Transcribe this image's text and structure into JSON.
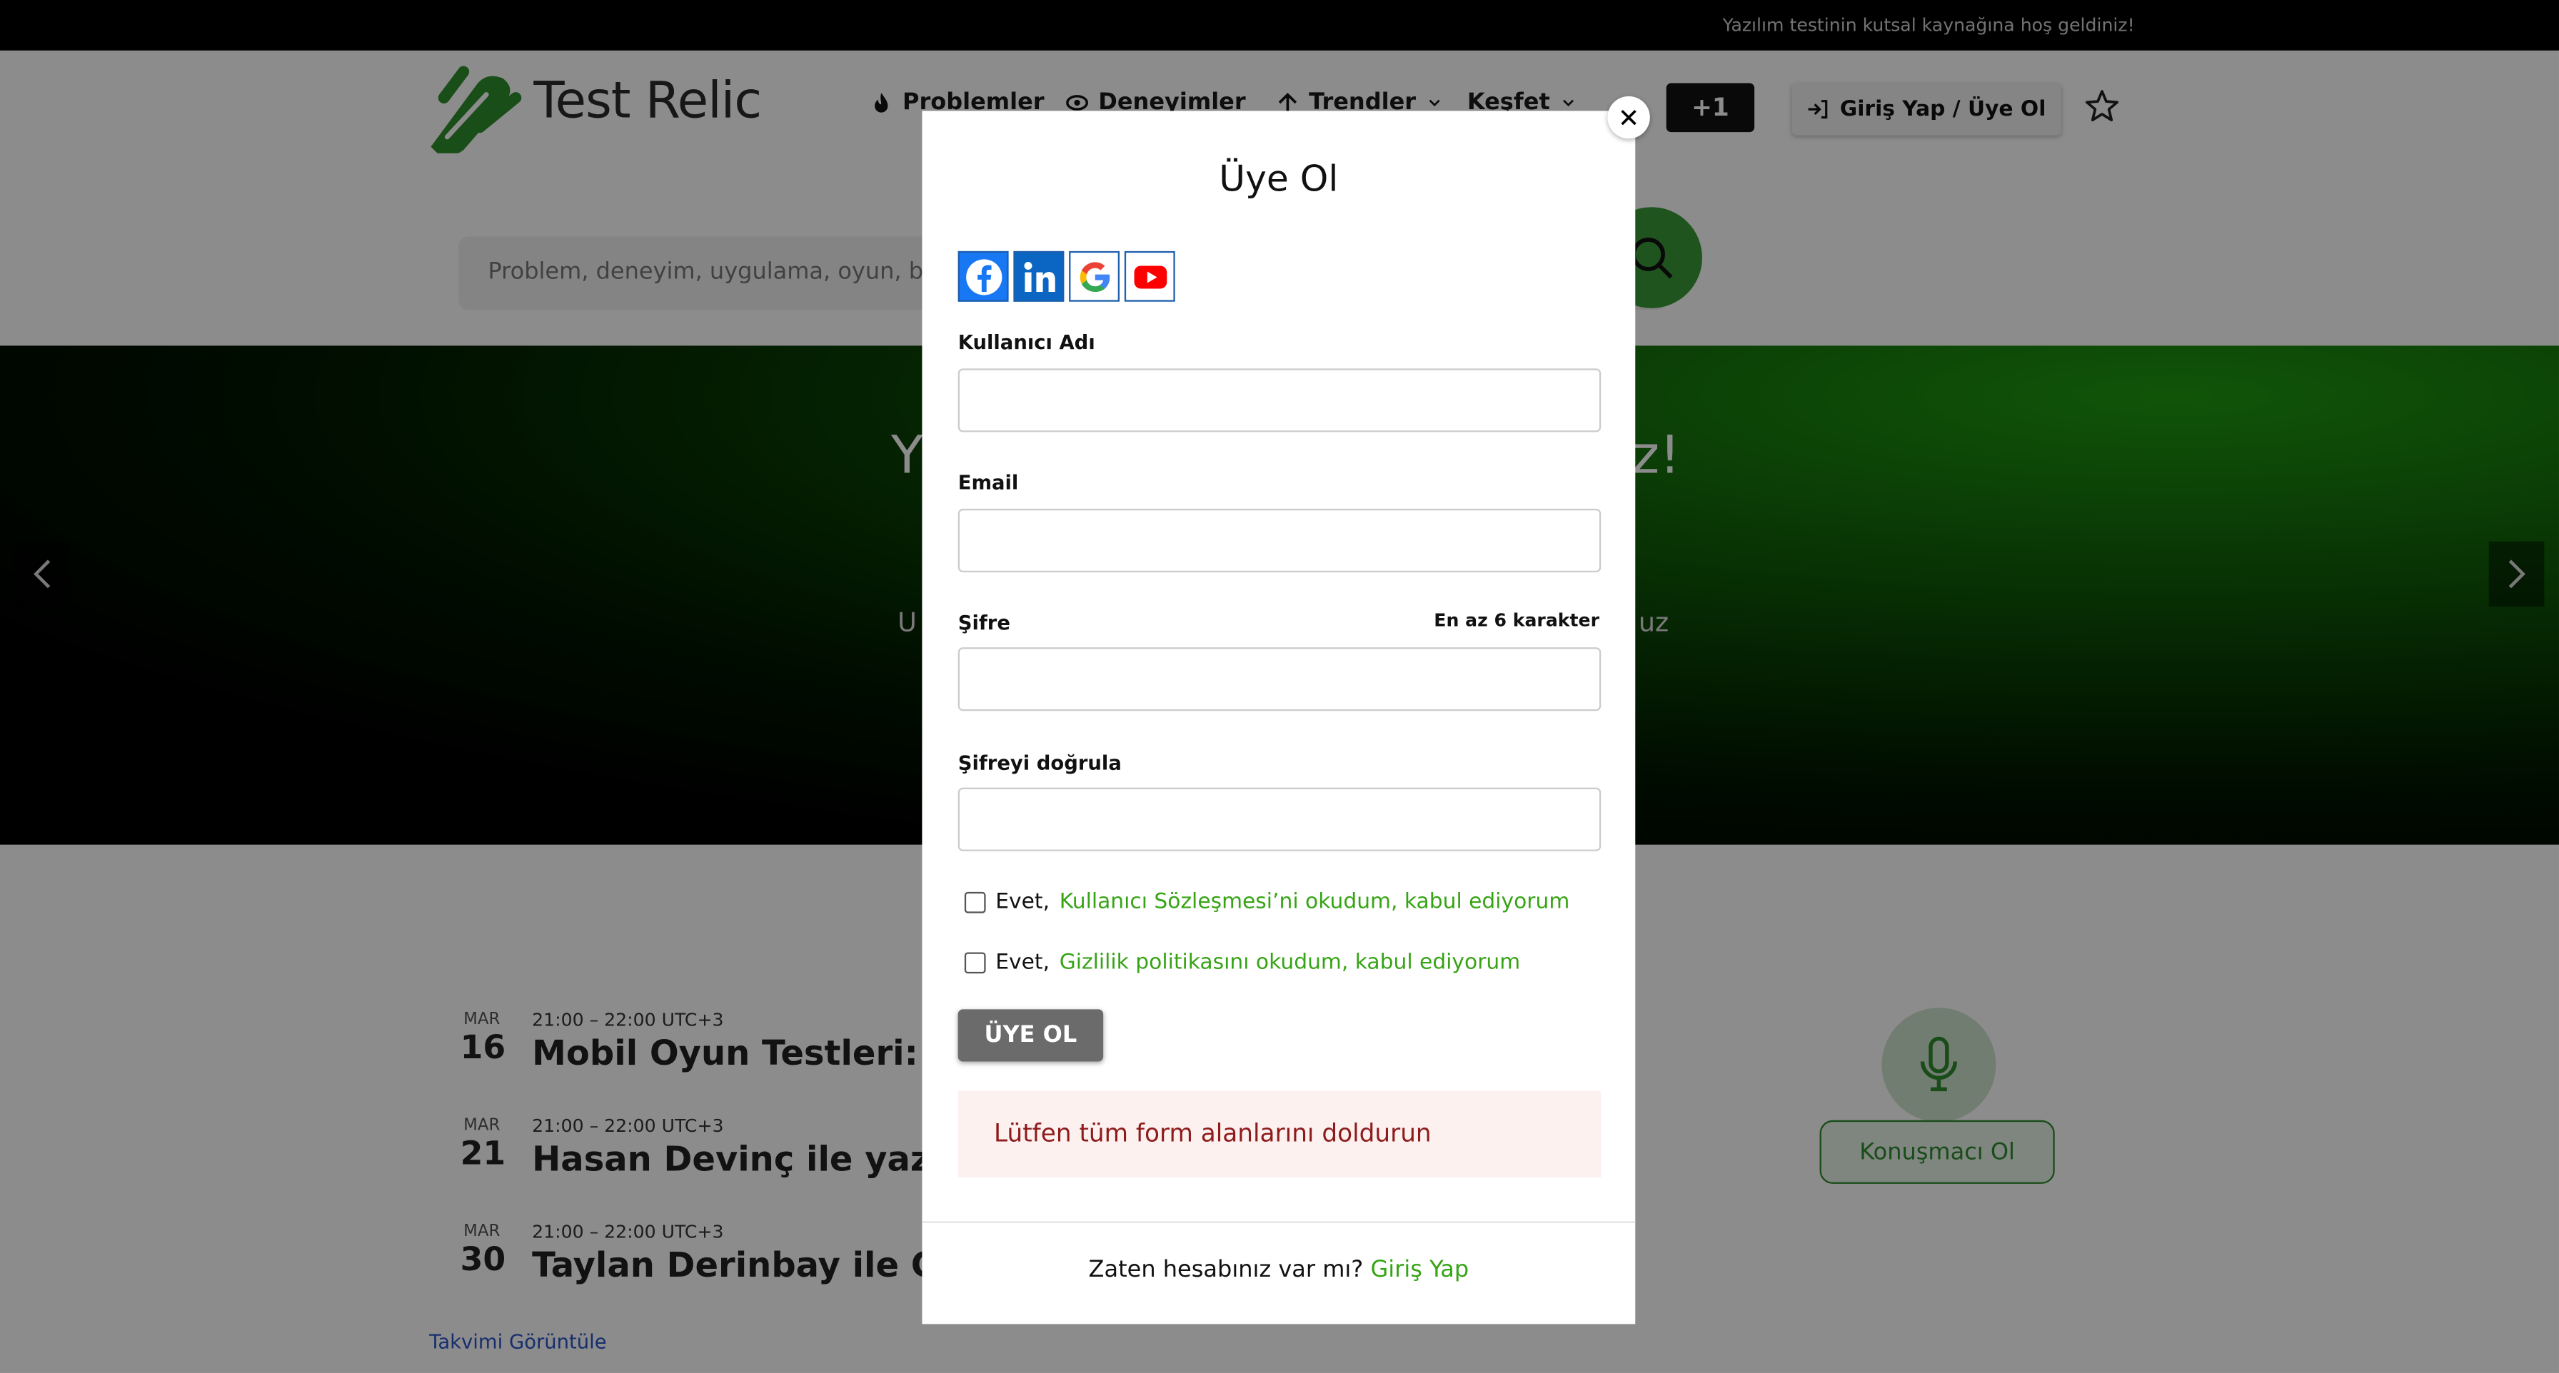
{
  "topbar": {
    "welcome": "Yazılım testinin kutsal kaynağına hoş geldiniz!"
  },
  "header": {
    "logo_text": "Test Relic",
    "nav": [
      {
        "label": "Problemler",
        "icon": "fire-icon"
      },
      {
        "label": "Deneyimler",
        "icon": "eye-icon"
      },
      {
        "label": "Trendler",
        "icon": "arrow-up-icon"
      },
      {
        "label": "Keşfet",
        "icon": "chevron-down-icon"
      }
    ],
    "plus_label": "+1",
    "login_label": "Giriş Yap / Üye Ol",
    "search_placeholder": "Problem, deneyim, uygulama, oyun, blog"
  },
  "hero": {
    "title_start": "Y",
    "title_end": "z!",
    "sub_start": "U",
    "sub_end": "uz"
  },
  "events": [
    {
      "month": "MAR",
      "day": "16",
      "time": "21:00 – 22:00 UTC+3",
      "title": "Mobil Oyun Testleri: Wor"
    },
    {
      "month": "MAR",
      "day": "21",
      "time": "21:00 – 22:00 UTC+3",
      "title": "Hasan Devinç ile yazılım"
    },
    {
      "month": "MAR",
      "day": "30",
      "time": "21:00 – 22:00 UTC+3",
      "title": "Taylan Derinbay ile CI/C"
    }
  ],
  "calendar_link": "Takvimi Görüntüle",
  "speaker_button": "Konuşmacı Ol",
  "modal": {
    "title": "Üye Ol",
    "close_symbol": "✕",
    "social": [
      "facebook-icon",
      "linkedin-icon",
      "google-icon",
      "youtube-icon"
    ],
    "username_label": "Kullanıcı Adı",
    "email_label": "Email",
    "password_label": "Şifre",
    "password_hint": "En az 6 karakter",
    "confirm_label": "Şifreyi doğrula",
    "terms_prefix": "Evet,",
    "terms_link": "Kullanıcı Sözleşmesi’ni okudum, kabul ediyorum",
    "privacy_prefix": "Evet,",
    "privacy_link": "Gizlilik politikasını okudum, kabul ediyorum",
    "submit_label": "ÜYE OL",
    "error_message": "Lütfen tüm form alanlarını doldurun",
    "footer_text": "Zaten hesabınız var mı?",
    "footer_link": "Giriş Yap"
  },
  "colors": {
    "brand_green": "#37a416",
    "error_text": "#8e1b1b",
    "error_bg": "#fdf1f0"
  }
}
